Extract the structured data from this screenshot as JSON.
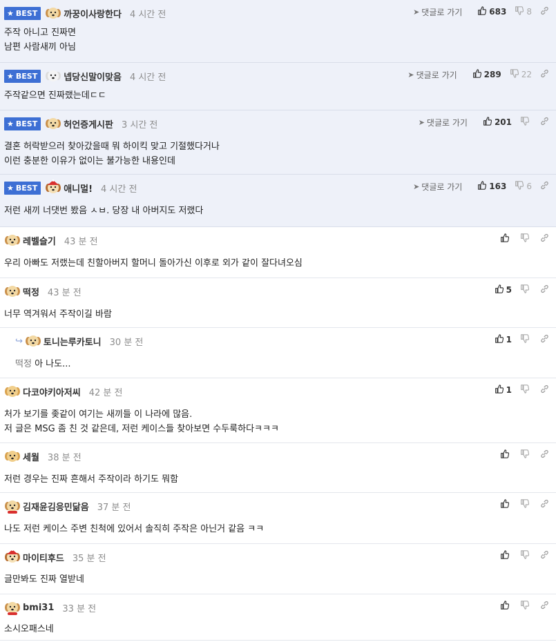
{
  "best_label": "BEST",
  "goto_label": "댓글로 가기",
  "colors": {
    "best_badge": "#3d6fd4",
    "best_bg": "#eef1f9"
  },
  "comments": [
    {
      "best": true,
      "nick": "까꿍이사랑한다",
      "time": "4 시간 전",
      "avatar": "puppy",
      "up": "683",
      "down": "8",
      "lines": [
        "주작 아니고 진짜면",
        "남편 사람새끼 아님"
      ]
    },
    {
      "best": true,
      "nick": "넵당신말이맞음",
      "time": "4 시간 전",
      "avatar": "white-dog",
      "up": "289",
      "down": "22",
      "lines": [
        "주작같으면 진짜랬는데ㄷㄷ"
      ]
    },
    {
      "best": true,
      "nick": "허언증게시판",
      "time": "3 시간 전",
      "avatar": "puppy",
      "up": "201",
      "down": "",
      "lines": [
        "결혼 허락받으러 찾아갔을때 뭐 하이킥 맞고 기절했다거나",
        "이런 충분한 이유가 없이는 불가능한 내용인데"
      ]
    },
    {
      "best": true,
      "nick": "애니멀!",
      "time": "4 시간 전",
      "avatar": "santa-dog",
      "up": "163",
      "down": "6",
      "lines": [
        "저런 새끼 너댓번 봤음 ㅅㅂ. 당장 내 아버지도 저랬다"
      ]
    },
    {
      "best": false,
      "nick": "레벨슬기",
      "time": "43 분 전",
      "avatar": "puppy",
      "up": "",
      "down": "",
      "lines": [
        "우리 아빠도 저랬는데 친할아버지 할머니 돌아가신 이후로 외가 같이 잘다녀오심"
      ]
    },
    {
      "best": false,
      "nick": "떡정",
      "time": "43 분 전",
      "avatar": "puppy",
      "up": "5",
      "down": "",
      "lines": [
        "너무 역겨워서 주작이길 바람"
      ]
    },
    {
      "best": false,
      "reply": true,
      "nick": "토니는루카토니",
      "time": "30 분 전",
      "avatar": "puppy",
      "up": "1",
      "down": "",
      "mention": "떡정",
      "lines": [
        "아 나도..."
      ]
    },
    {
      "best": false,
      "nick": "다코야키아저씨",
      "time": "42 분 전",
      "avatar": "golden",
      "up": "1",
      "down": "",
      "lines": [
        "처가 보기를 좆같이 여기는 새끼들 이 나라에 많음.",
        "저 글은 MSG 좀 친 것 같은데, 저런 케이스들 찾아보면 수두룩하다ㅋㅋㅋ"
      ]
    },
    {
      "best": false,
      "nick": "세월",
      "time": "38 분 전",
      "avatar": "golden",
      "up": "",
      "down": "",
      "lines": [
        "저런 경우는 진짜 흔해서 주작이라 하기도 뭐함"
      ]
    },
    {
      "best": false,
      "nick": "김재윤김응민닮음",
      "time": "37 분 전",
      "avatar": "santa-puppy",
      "up": "",
      "down": "",
      "lines": [
        "나도 저런 케이스 주변 친척에 있어서 솔직히 주작은 아닌거 같음 ㅋㅋ"
      ]
    },
    {
      "best": false,
      "nick": "마이티후드",
      "time": "35 분 전",
      "avatar": "santa-dog",
      "up": "",
      "down": "",
      "lines": [
        "글만봐도 진짜 열받네"
      ]
    },
    {
      "best": false,
      "nick": "bmi31",
      "time": "33 분 전",
      "avatar": "santa-puppy",
      "up": "",
      "down": "",
      "lines": [
        "소시오패스네"
      ]
    }
  ]
}
